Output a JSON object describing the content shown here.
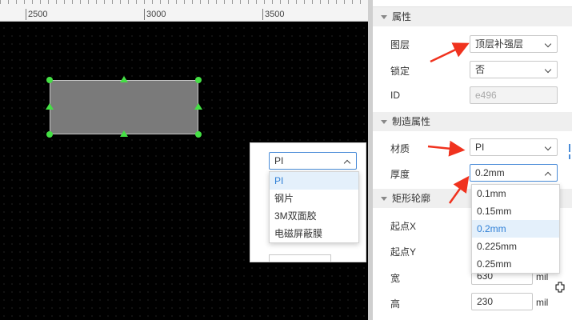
{
  "ruler": {
    "ticks": [
      "2500",
      "3000",
      "3500"
    ]
  },
  "properties": {
    "section_title": "属性",
    "layer_label": "图层",
    "layer_value": "顶层补强层",
    "lock_label": "锁定",
    "lock_value": "否",
    "id_label": "ID",
    "id_value": "e496"
  },
  "manufacturing": {
    "section_title": "制造属性",
    "material_label": "材质",
    "material_value": "PI",
    "thickness_label": "厚度",
    "thickness_value": "0.2mm",
    "thickness_options": [
      "0.1mm",
      "0.15mm",
      "0.2mm",
      "0.225mm",
      "0.25mm"
    ],
    "thickness_selected_index": 2
  },
  "rect_outline": {
    "section_title": "矩形轮廓",
    "startx_label": "起点X",
    "starty_label": "起点Y",
    "width_label": "宽",
    "width_value": "630",
    "width_unit": "mil",
    "height_label": "高",
    "height_value": "230",
    "height_unit": "mil"
  },
  "material_popup": {
    "value": "PI",
    "options": [
      "PI",
      "钢片",
      "3M双面胶",
      "电磁屏蔽膜"
    ],
    "selected_index": 0
  },
  "colors": {
    "accent": "#2f7fd6",
    "handle": "#44e044",
    "annotation": "#f0321e"
  }
}
